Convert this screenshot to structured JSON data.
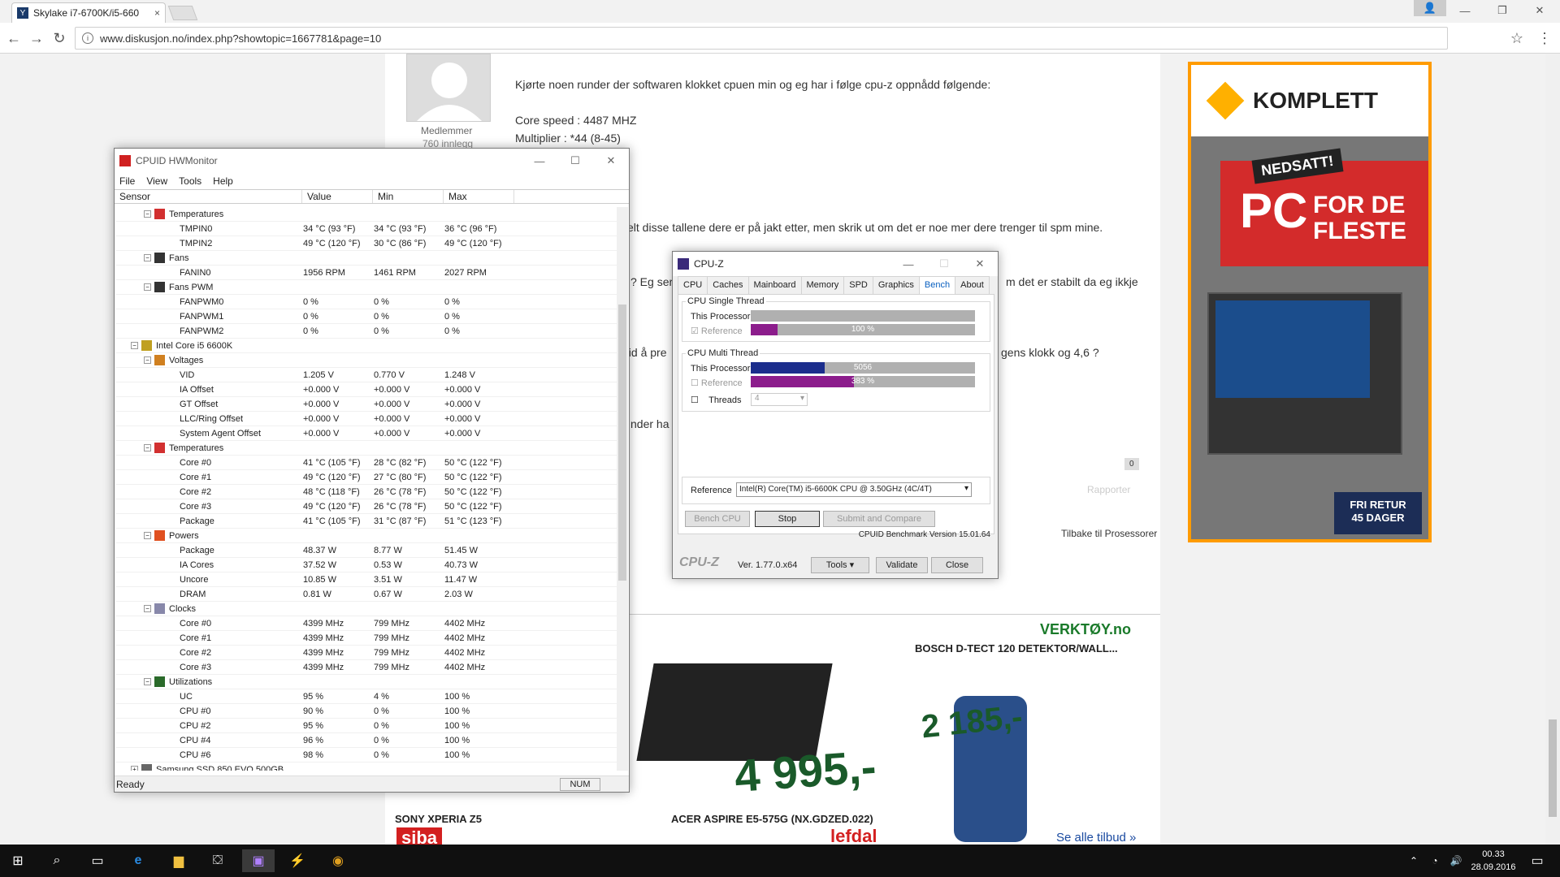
{
  "browser": {
    "tab_title": "Skylake i7-6700K/i5-660",
    "url": "www.diskusjon.no/index.php?showtopic=1667781&page=10",
    "tab_close": "×"
  },
  "post": {
    "user_group": "Medlemmer",
    "posts": "760 innlegg",
    "line1": "Kjørte noen runder der softwaren klokket cpuen min og eg har i følge cpu-z oppnådd følgende:",
    "core_speed": "Core speed : 4487 MHZ",
    "multiplier": "Multiplier     : *44 (8-45)",
    "line2": "elt disse tallene dere er på jakt etter, men skrik ut om det er noe mer dere trenger til spm mine.",
    "line3a": "? Eg ser",
    "line3b": "m det er stabilt da eg ikkje",
    "line4a": "eid å pre",
    "line4b": "gens klokk og 4,6 ?",
    "line5": "nder ha",
    "like_count": "0",
    "report": "Rapporter",
    "back_link": "Tilbake til Prosessorer"
  },
  "ad": {
    "brand": "KOMPLETT",
    "badge": "NEDSATT!",
    "headline1": "PC",
    "headline2": "FOR DE",
    "headline3": "FLESTE",
    "return": "FRI RETUR",
    "days": "45 DAGER"
  },
  "ad2": {
    "brand": "VERKTØY.no",
    "product1": "BOSCH D-TECT 120 DETEKTOR/WALL...",
    "price1": "2 185,-",
    "price2": "4 995,-",
    "product2": "ACER ASPIRE E5-575G (NX.GDZED.022)",
    "product3": "SONY XPERIA Z5",
    "more": "Se alle tilbud »",
    "store1": "lefdal",
    "store2": "siba"
  },
  "hwmonitor": {
    "title": "CPUID HWMonitor",
    "menu": [
      "File",
      "View",
      "Tools",
      "Help"
    ],
    "columns": [
      "Sensor",
      "Value",
      "Min",
      "Max"
    ],
    "status": "Ready",
    "num": "NUM",
    "rows": [
      {
        "lvl": 2,
        "exp": "−",
        "icon": "thermo",
        "name": "Temperatures",
        "v": "",
        "mn": "",
        "mx": ""
      },
      {
        "lvl": 3,
        "name": "TMPIN0",
        "v": "34 °C  (93 °F)",
        "mn": "34 °C  (93 °F)",
        "mx": "36 °C  (96 °F)"
      },
      {
        "lvl": 3,
        "name": "TMPIN2",
        "v": "49 °C  (120 °F)",
        "mn": "30 °C  (86 °F)",
        "mx": "49 °C  (120 °F)"
      },
      {
        "lvl": 2,
        "exp": "−",
        "icon": "fan",
        "name": "Fans",
        "v": "",
        "mn": "",
        "mx": ""
      },
      {
        "lvl": 3,
        "name": "FANIN0",
        "v": "1956 RPM",
        "mn": "1461 RPM",
        "mx": "2027 RPM"
      },
      {
        "lvl": 2,
        "exp": "−",
        "icon": "fan",
        "name": "Fans PWM",
        "v": "",
        "mn": "",
        "mx": ""
      },
      {
        "lvl": 3,
        "name": "FANPWM0",
        "v": "0 %",
        "mn": "0 %",
        "mx": "0 %"
      },
      {
        "lvl": 3,
        "name": "FANPWM1",
        "v": "0 %",
        "mn": "0 %",
        "mx": "0 %"
      },
      {
        "lvl": 3,
        "name": "FANPWM2",
        "v": "0 %",
        "mn": "0 %",
        "mx": "0 %"
      },
      {
        "lvl": 1,
        "exp": "−",
        "icon": "chip",
        "name": "Intel Core i5 6600K",
        "v": "",
        "mn": "",
        "mx": ""
      },
      {
        "lvl": 2,
        "exp": "−",
        "icon": "volt",
        "name": "Voltages",
        "v": "",
        "mn": "",
        "mx": ""
      },
      {
        "lvl": 3,
        "name": "VID",
        "v": "1.205 V",
        "mn": "0.770 V",
        "mx": "1.248 V"
      },
      {
        "lvl": 3,
        "name": "IA Offset",
        "v": "+0.000 V",
        "mn": "+0.000 V",
        "mx": "+0.000 V"
      },
      {
        "lvl": 3,
        "name": "GT Offset",
        "v": "+0.000 V",
        "mn": "+0.000 V",
        "mx": "+0.000 V"
      },
      {
        "lvl": 3,
        "name": "LLC/Ring Offset",
        "v": "+0.000 V",
        "mn": "+0.000 V",
        "mx": "+0.000 V"
      },
      {
        "lvl": 3,
        "name": "System Agent Offset",
        "v": "+0.000 V",
        "mn": "+0.000 V",
        "mx": "+0.000 V"
      },
      {
        "lvl": 2,
        "exp": "−",
        "icon": "thermo",
        "name": "Temperatures",
        "v": "",
        "mn": "",
        "mx": ""
      },
      {
        "lvl": 3,
        "name": "Core #0",
        "v": "41 °C  (105 °F)",
        "mn": "28 °C  (82 °F)",
        "mx": "50 °C  (122 °F)"
      },
      {
        "lvl": 3,
        "name": "Core #1",
        "v": "49 °C  (120 °F)",
        "mn": "27 °C  (80 °F)",
        "mx": "50 °C  (122 °F)"
      },
      {
        "lvl": 3,
        "name": "Core #2",
        "v": "48 °C  (118 °F)",
        "mn": "26 °C  (78 °F)",
        "mx": "50 °C  (122 °F)"
      },
      {
        "lvl": 3,
        "name": "Core #3",
        "v": "49 °C  (120 °F)",
        "mn": "26 °C  (78 °F)",
        "mx": "50 °C  (122 °F)"
      },
      {
        "lvl": 3,
        "name": "Package",
        "v": "41 °C  (105 °F)",
        "mn": "31 °C  (87 °F)",
        "mx": "51 °C  (123 °F)"
      },
      {
        "lvl": 2,
        "exp": "−",
        "icon": "power",
        "name": "Powers",
        "v": "",
        "mn": "",
        "mx": ""
      },
      {
        "lvl": 3,
        "name": "Package",
        "v": "48.37 W",
        "mn": "8.77 W",
        "mx": "51.45 W"
      },
      {
        "lvl": 3,
        "name": "IA Cores",
        "v": "37.52 W",
        "mn": "0.53 W",
        "mx": "40.73 W"
      },
      {
        "lvl": 3,
        "name": "Uncore",
        "v": "10.85 W",
        "mn": "3.51 W",
        "mx": "11.47 W"
      },
      {
        "lvl": 3,
        "name": "DRAM",
        "v": "0.81 W",
        "mn": "0.67 W",
        "mx": "2.03 W"
      },
      {
        "lvl": 2,
        "exp": "−",
        "icon": "clock",
        "name": "Clocks",
        "v": "",
        "mn": "",
        "mx": ""
      },
      {
        "lvl": 3,
        "name": "Core #0",
        "v": "4399 MHz",
        "mn": "799 MHz",
        "mx": "4402 MHz"
      },
      {
        "lvl": 3,
        "name": "Core #1",
        "v": "4399 MHz",
        "mn": "799 MHz",
        "mx": "4402 MHz"
      },
      {
        "lvl": 3,
        "name": "Core #2",
        "v": "4399 MHz",
        "mn": "799 MHz",
        "mx": "4402 MHz"
      },
      {
        "lvl": 3,
        "name": "Core #3",
        "v": "4399 MHz",
        "mn": "799 MHz",
        "mx": "4402 MHz"
      },
      {
        "lvl": 2,
        "exp": "−",
        "icon": "util",
        "name": "Utilizations",
        "v": "",
        "mn": "",
        "mx": ""
      },
      {
        "lvl": 3,
        "name": "UC",
        "v": "95 %",
        "mn": "4 %",
        "mx": "100 %"
      },
      {
        "lvl": 3,
        "name": "CPU #0",
        "v": "90 %",
        "mn": "0 %",
        "mx": "100 %"
      },
      {
        "lvl": 3,
        "name": "CPU #2",
        "v": "95 %",
        "mn": "0 %",
        "mx": "100 %"
      },
      {
        "lvl": 3,
        "name": "CPU #4",
        "v": "96 %",
        "mn": "0 %",
        "mx": "100 %"
      },
      {
        "lvl": 3,
        "name": "CPU #6",
        "v": "98 %",
        "mn": "0 %",
        "mx": "100 %"
      },
      {
        "lvl": 1,
        "exp": "+",
        "icon": "disk",
        "name": "Samsung SSD 850 EVO 500GB",
        "v": "",
        "mn": "",
        "mx": ""
      }
    ]
  },
  "cpuz": {
    "title": "CPU-Z",
    "tabs": [
      "CPU",
      "Caches",
      "Mainboard",
      "Memory",
      "SPD",
      "Graphics",
      "Bench",
      "About"
    ],
    "active_tab": "Bench",
    "single_label": "CPU Single Thread",
    "multi_label": "CPU Multi Thread",
    "this_processor": "This Processor",
    "reference": "Reference",
    "single_ref_text": "100 %",
    "single_ref_fraction": 0.12,
    "multi_this_text": "5056",
    "multi_this_fraction": 0.33,
    "multi_ref_text": "383 %",
    "multi_ref_fraction": 0.46,
    "threads_label": "Threads",
    "threads_value": "4",
    "reference_label": "Reference",
    "reference_value": "Intel(R) Core(TM) i5-6600K CPU @ 3.50GHz (4C/4T)",
    "bench_cpu": "Bench CPU",
    "stop": "Stop",
    "submit": "Submit and Compare",
    "bench_version": "CPUID Benchmark Version 15.01.64",
    "logo": "CPU-Z",
    "version": "Ver. 1.77.0.x64",
    "tools": "Tools",
    "validate": "Validate",
    "close": "Close",
    "colors": {
      "purple": "#8c1d8c",
      "blue": "#1b2d8c"
    }
  },
  "taskbar": {
    "time": "00.33",
    "date": "28.09.2016"
  }
}
